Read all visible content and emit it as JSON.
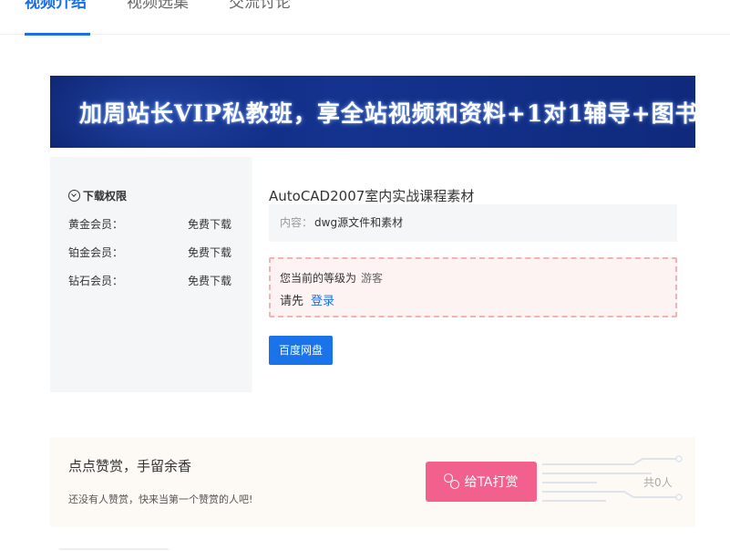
{
  "tabs": [
    {
      "label": "视频介绍",
      "active": true
    },
    {
      "label": "视频选集",
      "active": false
    },
    {
      "label": "交流讨论",
      "active": false
    }
  ],
  "banner": {
    "text": "加周站长VIP私教班，享全站视频和资料+1对1辅导+图书"
  },
  "download": {
    "title": "下载权限",
    "permissions": [
      {
        "level": "黄金会员：",
        "value": "免费下载"
      },
      {
        "level": "铂金会员：",
        "value": "免费下载"
      },
      {
        "level": "钻石会员：",
        "value": "免费下载"
      }
    ],
    "resource_title": "AutoCAD2007室内实战课程素材",
    "content_label": "内容：",
    "content_value": "dwg源文件和素材",
    "notice_level_text": "您当前的等级为",
    "notice_level_value": "游客",
    "notice_prompt": "请先",
    "login_label": "登录",
    "button_label": "百度网盘"
  },
  "reward": {
    "title": "点点赞赏，手留余香",
    "subtitle": "还没有人赞赏，快来当第一个赞赏的人吧!",
    "button_label": "给TA打赏",
    "count": "共0人"
  },
  "colors": {
    "accent": "#1a6fe6",
    "reward_button": "#f2608d",
    "notice_border": "#f2b3b3"
  }
}
